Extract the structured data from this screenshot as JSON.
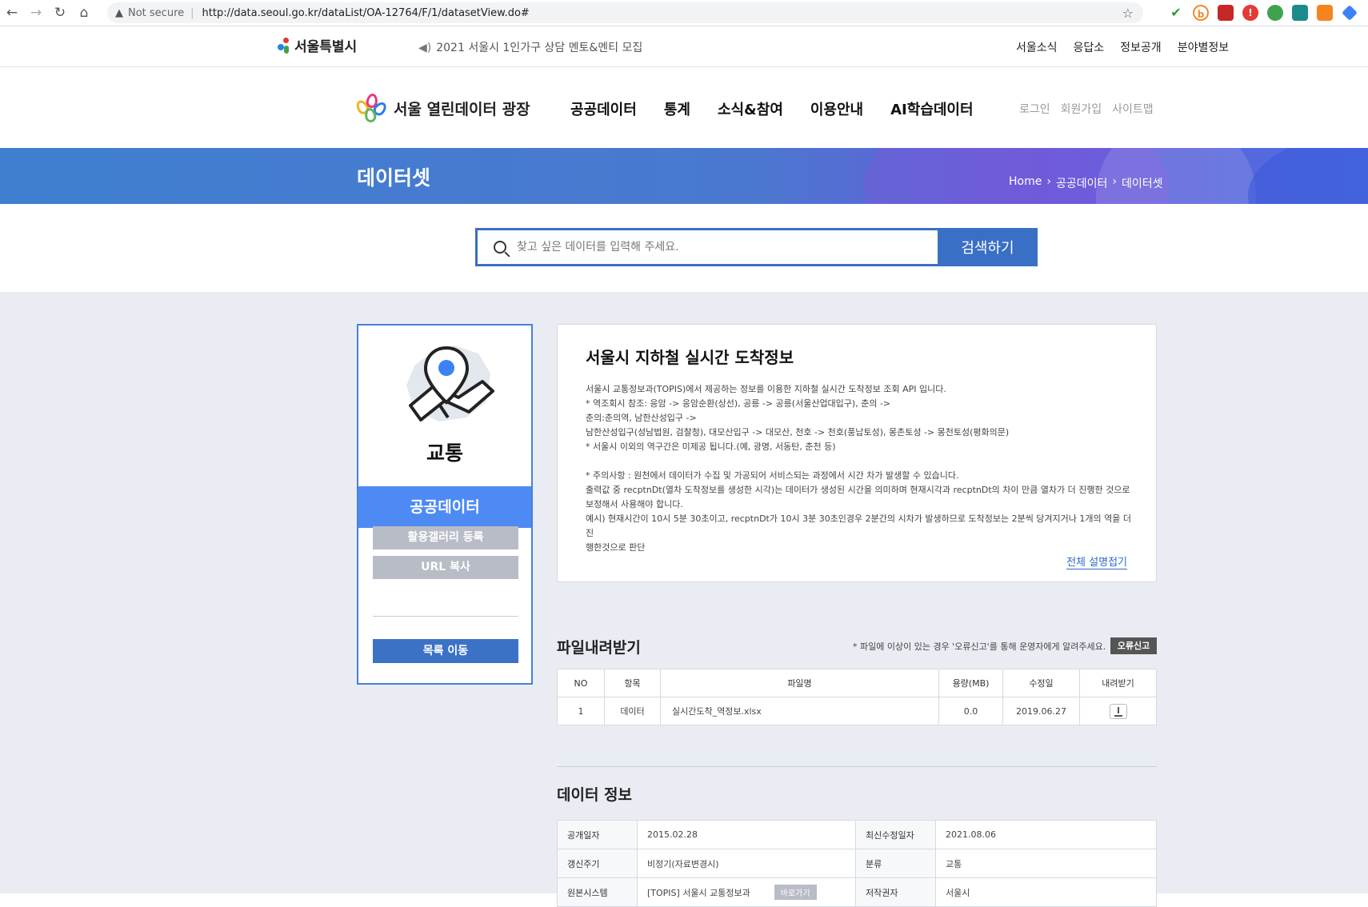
{
  "browser": {
    "security": "Not secure",
    "url": "http://data.seoul.go.kr/dataList/OA-12764/F/1/datasetView.do#"
  },
  "topbar": {
    "logo_text": "서울특별시",
    "notice": "2021 서울시 1인가구 상담 멘토&멘티 모집",
    "links": [
      "서울소식",
      "응답소",
      "정보공개",
      "분야별정보"
    ]
  },
  "nav": {
    "brand": "서울 열린데이터 광장",
    "menu": [
      "공공데이터",
      "통계",
      "소식&참여",
      "이용안내",
      "AI학습데이터"
    ],
    "util": [
      "로그인",
      "회원가입",
      "사이트맵"
    ]
  },
  "hero": {
    "title": "데이터셋",
    "breadcrumb": [
      "Home",
      "공공데이터",
      "데이터셋"
    ]
  },
  "search": {
    "placeholder": "찾고 싶은 데이터를 입력해 주세요.",
    "button": "검색하기"
  },
  "sidebar": {
    "category": "교통",
    "type": "공공데이터",
    "gallery_button": "활용갤러리 등록",
    "url_button": "URL 복사",
    "list_button": "목록 이동"
  },
  "dataset": {
    "title": "서울시 지하철 실시간 도착정보",
    "description": [
      "서울시 교통정보과(TOPIS)에서 제공하는 정보를 이용한 지하철 실시간 도착정보 조회 API 입니다.",
      "* 역조회시 참조: 응암 -> 응암순환(상선), 공릉 -> 공릉(서울산업대입구), 춘의 ->",
      "춘의:춘의역, 남한산성입구 ->",
      "남한산성입구(성남법원, 검찰청), 대모산입구 -> 대모산, 천호 -> 천호(풍납토성), 몽촌토성 -> 몽천토성(평화의문)",
      "* 서울시 이외의 역구간은 미제공 됩니다.(예, 광명, 서동탄, 춘천 등)",
      "",
      "* 주의사항 : 원천에서 데이터가 수집 및 가공되어 서비스되는 과정에서 시간 차가 발생할 수 있습니다.",
      "출력값 중 recptnDt(열차 도착정보를 생성한 시각)는 데이터가 생성된 시간을 의미하며 현재시각과 recptnDt의 차이 만큼 열차가 더 진행한 것으로",
      "보정해서 사용해야 합니다.",
      "예시) 현재시간이 10시 5분 30초이고, recptnDt가 10시 3분 30초인경우 2분간의 시차가 발생하므로 도착정보는 2분씩 당겨지거나 1개의 역을 더 진",
      "행한것으로 판단"
    ],
    "fold_link": "전체 설명접기"
  },
  "files": {
    "title": "파일내려받기",
    "note": "* 파일에 이상이 있는 경우 '오류신고'를 통해 운영자에게 알려주세요.",
    "error_button": "오류신고",
    "headers": [
      "NO",
      "항목",
      "파일명",
      "용량(MB)",
      "수정일",
      "내려받기"
    ],
    "rows": [
      {
        "no": "1",
        "item": "데이터",
        "name": "실시간도착_역정보.xlsx",
        "size": "0.0",
        "date": "2019.06.27"
      }
    ]
  },
  "info": {
    "title": "데이터 정보",
    "rows": [
      {
        "k1": "공개일자",
        "v1": "2015.02.28",
        "k2": "최신수정일자",
        "v2": "2021.08.06"
      },
      {
        "k1": "갱신주기",
        "v1": "비정기(자료변경시)",
        "k2": "분류",
        "v2": "교통"
      },
      {
        "k1": "원본시스템",
        "v1": "[TOPIS] 서울시 교통정보과",
        "k2": "저작권자",
        "v2": "서울시"
      }
    ],
    "go_button": "바로가기"
  }
}
